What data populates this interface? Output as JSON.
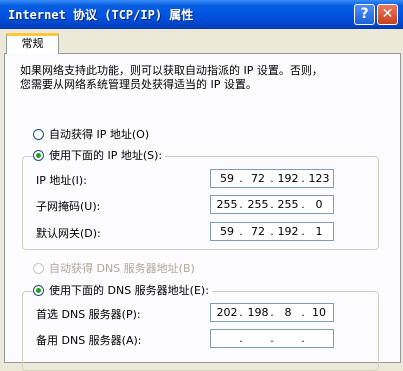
{
  "window": {
    "title": "Internet 协议 (TCP/IP) 属性",
    "help_label": "?",
    "close_label": "✕"
  },
  "tabs": [
    {
      "label": "常规"
    }
  ],
  "intro": {
    "line1": "如果网络支持此功能，则可以获取自动指派的 IP 设置。否则，",
    "line2": "您需要从网络系统管理员处获得适当的 IP 设置。"
  },
  "ip_section": {
    "auto_label": "自动获得 IP 地址(O)",
    "manual_label": "使用下面的 IP 地址(S):",
    "selected": "manual",
    "fields": [
      {
        "label": "IP 地址(I):",
        "octets": [
          "59",
          "72",
          "192",
          "123"
        ]
      },
      {
        "label": "子网掩码(U):",
        "octets": [
          "255",
          "255",
          "255",
          "0"
        ]
      },
      {
        "label": "默认网关(D):",
        "octets": [
          "59",
          "72",
          "192",
          "1"
        ]
      }
    ]
  },
  "dns_section": {
    "auto_label": "自动获得 DNS 服务器地址(B)",
    "manual_label": "使用下面的 DNS 服务器地址(E):",
    "selected": "manual",
    "auto_enabled": false,
    "fields": [
      {
        "label": "首选 DNS 服务器(P):",
        "octets": [
          "202",
          "198",
          "8",
          "10"
        ]
      },
      {
        "label": "备用 DNS 服务器(A):",
        "octets": [
          "",
          "",
          "",
          ""
        ]
      }
    ]
  },
  "colors": {
    "titlebar": "#0054e3",
    "tab_highlight": "#ffc73c",
    "radio_dot": "#21a121",
    "disabled_text": "#aca899"
  }
}
